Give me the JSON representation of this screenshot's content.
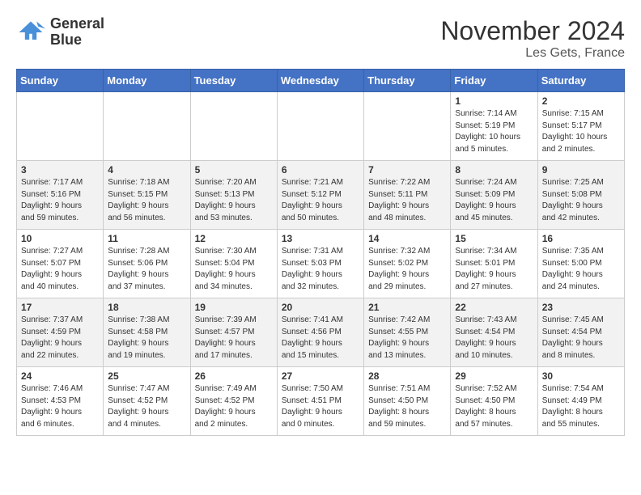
{
  "header": {
    "logo_line1": "General",
    "logo_line2": "Blue",
    "month": "November 2024",
    "location": "Les Gets, France"
  },
  "days_of_week": [
    "Sunday",
    "Monday",
    "Tuesday",
    "Wednesday",
    "Thursday",
    "Friday",
    "Saturday"
  ],
  "weeks": [
    [
      {
        "day": "",
        "info": ""
      },
      {
        "day": "",
        "info": ""
      },
      {
        "day": "",
        "info": ""
      },
      {
        "day": "",
        "info": ""
      },
      {
        "day": "",
        "info": ""
      },
      {
        "day": "1",
        "info": "Sunrise: 7:14 AM\nSunset: 5:19 PM\nDaylight: 10 hours\nand 5 minutes."
      },
      {
        "day": "2",
        "info": "Sunrise: 7:15 AM\nSunset: 5:17 PM\nDaylight: 10 hours\nand 2 minutes."
      }
    ],
    [
      {
        "day": "3",
        "info": "Sunrise: 7:17 AM\nSunset: 5:16 PM\nDaylight: 9 hours\nand 59 minutes."
      },
      {
        "day": "4",
        "info": "Sunrise: 7:18 AM\nSunset: 5:15 PM\nDaylight: 9 hours\nand 56 minutes."
      },
      {
        "day": "5",
        "info": "Sunrise: 7:20 AM\nSunset: 5:13 PM\nDaylight: 9 hours\nand 53 minutes."
      },
      {
        "day": "6",
        "info": "Sunrise: 7:21 AM\nSunset: 5:12 PM\nDaylight: 9 hours\nand 50 minutes."
      },
      {
        "day": "7",
        "info": "Sunrise: 7:22 AM\nSunset: 5:11 PM\nDaylight: 9 hours\nand 48 minutes."
      },
      {
        "day": "8",
        "info": "Sunrise: 7:24 AM\nSunset: 5:09 PM\nDaylight: 9 hours\nand 45 minutes."
      },
      {
        "day": "9",
        "info": "Sunrise: 7:25 AM\nSunset: 5:08 PM\nDaylight: 9 hours\nand 42 minutes."
      }
    ],
    [
      {
        "day": "10",
        "info": "Sunrise: 7:27 AM\nSunset: 5:07 PM\nDaylight: 9 hours\nand 40 minutes."
      },
      {
        "day": "11",
        "info": "Sunrise: 7:28 AM\nSunset: 5:06 PM\nDaylight: 9 hours\nand 37 minutes."
      },
      {
        "day": "12",
        "info": "Sunrise: 7:30 AM\nSunset: 5:04 PM\nDaylight: 9 hours\nand 34 minutes."
      },
      {
        "day": "13",
        "info": "Sunrise: 7:31 AM\nSunset: 5:03 PM\nDaylight: 9 hours\nand 32 minutes."
      },
      {
        "day": "14",
        "info": "Sunrise: 7:32 AM\nSunset: 5:02 PM\nDaylight: 9 hours\nand 29 minutes."
      },
      {
        "day": "15",
        "info": "Sunrise: 7:34 AM\nSunset: 5:01 PM\nDaylight: 9 hours\nand 27 minutes."
      },
      {
        "day": "16",
        "info": "Sunrise: 7:35 AM\nSunset: 5:00 PM\nDaylight: 9 hours\nand 24 minutes."
      }
    ],
    [
      {
        "day": "17",
        "info": "Sunrise: 7:37 AM\nSunset: 4:59 PM\nDaylight: 9 hours\nand 22 minutes."
      },
      {
        "day": "18",
        "info": "Sunrise: 7:38 AM\nSunset: 4:58 PM\nDaylight: 9 hours\nand 19 minutes."
      },
      {
        "day": "19",
        "info": "Sunrise: 7:39 AM\nSunset: 4:57 PM\nDaylight: 9 hours\nand 17 minutes."
      },
      {
        "day": "20",
        "info": "Sunrise: 7:41 AM\nSunset: 4:56 PM\nDaylight: 9 hours\nand 15 minutes."
      },
      {
        "day": "21",
        "info": "Sunrise: 7:42 AM\nSunset: 4:55 PM\nDaylight: 9 hours\nand 13 minutes."
      },
      {
        "day": "22",
        "info": "Sunrise: 7:43 AM\nSunset: 4:54 PM\nDaylight: 9 hours\nand 10 minutes."
      },
      {
        "day": "23",
        "info": "Sunrise: 7:45 AM\nSunset: 4:54 PM\nDaylight: 9 hours\nand 8 minutes."
      }
    ],
    [
      {
        "day": "24",
        "info": "Sunrise: 7:46 AM\nSunset: 4:53 PM\nDaylight: 9 hours\nand 6 minutes."
      },
      {
        "day": "25",
        "info": "Sunrise: 7:47 AM\nSunset: 4:52 PM\nDaylight: 9 hours\nand 4 minutes."
      },
      {
        "day": "26",
        "info": "Sunrise: 7:49 AM\nSunset: 4:52 PM\nDaylight: 9 hours\nand 2 minutes."
      },
      {
        "day": "27",
        "info": "Sunrise: 7:50 AM\nSunset: 4:51 PM\nDaylight: 9 hours\nand 0 minutes."
      },
      {
        "day": "28",
        "info": "Sunrise: 7:51 AM\nSunset: 4:50 PM\nDaylight: 8 hours\nand 59 minutes."
      },
      {
        "day": "29",
        "info": "Sunrise: 7:52 AM\nSunset: 4:50 PM\nDaylight: 8 hours\nand 57 minutes."
      },
      {
        "day": "30",
        "info": "Sunrise: 7:54 AM\nSunset: 4:49 PM\nDaylight: 8 hours\nand 55 minutes."
      }
    ]
  ]
}
